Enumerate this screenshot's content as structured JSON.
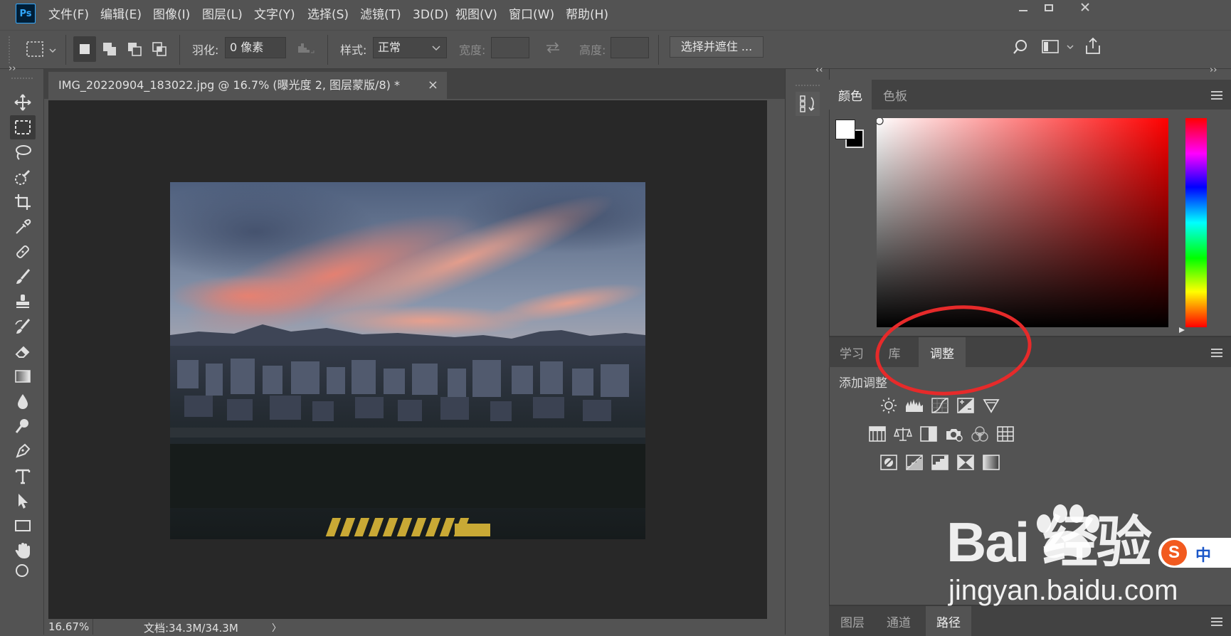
{
  "app": {
    "logo": "Ps"
  },
  "menu": [
    "文件(F)",
    "编辑(E)",
    "图像(I)",
    "图层(L)",
    "文字(Y)",
    "选择(S)",
    "滤镜(T)",
    "3D(D)",
    "视图(V)",
    "窗口(W)",
    "帮助(H)"
  ],
  "options": {
    "feather_label": "羽化:",
    "feather_value": "0 像素",
    "style_label": "样式:",
    "style_value": "正常",
    "width_label": "宽度:",
    "height_label": "高度:",
    "select_mask_button": "选择并遮住 ..."
  },
  "document": {
    "tab_title": "IMG_20220904_183022.jpg @ 16.7% (曝光度 2, 图层蒙版/8) *",
    "close": "×",
    "zoom": "16.67%",
    "doc_info": "文档:34.3M/34.3M",
    "status_arrow": "〉"
  },
  "panels": {
    "color_tabs": [
      "颜色",
      "色板"
    ],
    "mid_tabs": [
      "学习",
      "库",
      "调整"
    ],
    "active_mid_tab": "调整",
    "adjust_title": "添加调整",
    "bottom_tabs": [
      "图层",
      "通道",
      "路径"
    ],
    "active_bottom_tab": "路径",
    "collapse_left": "‹‹",
    "collapse_right": "››",
    "toolbar_collapse": "››"
  },
  "watermark": {
    "logo": "Bai  经验",
    "url": "jingyan.baidu.com",
    "ime": "中"
  },
  "colors": {
    "ui_bg": "#535353",
    "canvas_bg": "#282828",
    "highlight_circle": "#e62a2a",
    "foreground": "#ffffff",
    "background": "#000000"
  },
  "icons": {
    "tools": [
      "move-icon",
      "marquee-icon",
      "lasso-icon",
      "quick-select-icon",
      "crop-icon",
      "eyedropper-icon",
      "healing-brush-icon",
      "brush-icon",
      "clone-stamp-icon",
      "history-brush-icon",
      "eraser-icon",
      "gradient-icon",
      "blur-icon",
      "dodge-icon",
      "pen-icon",
      "type-icon",
      "path-select-icon",
      "rectangle-icon",
      "hand-icon"
    ]
  }
}
